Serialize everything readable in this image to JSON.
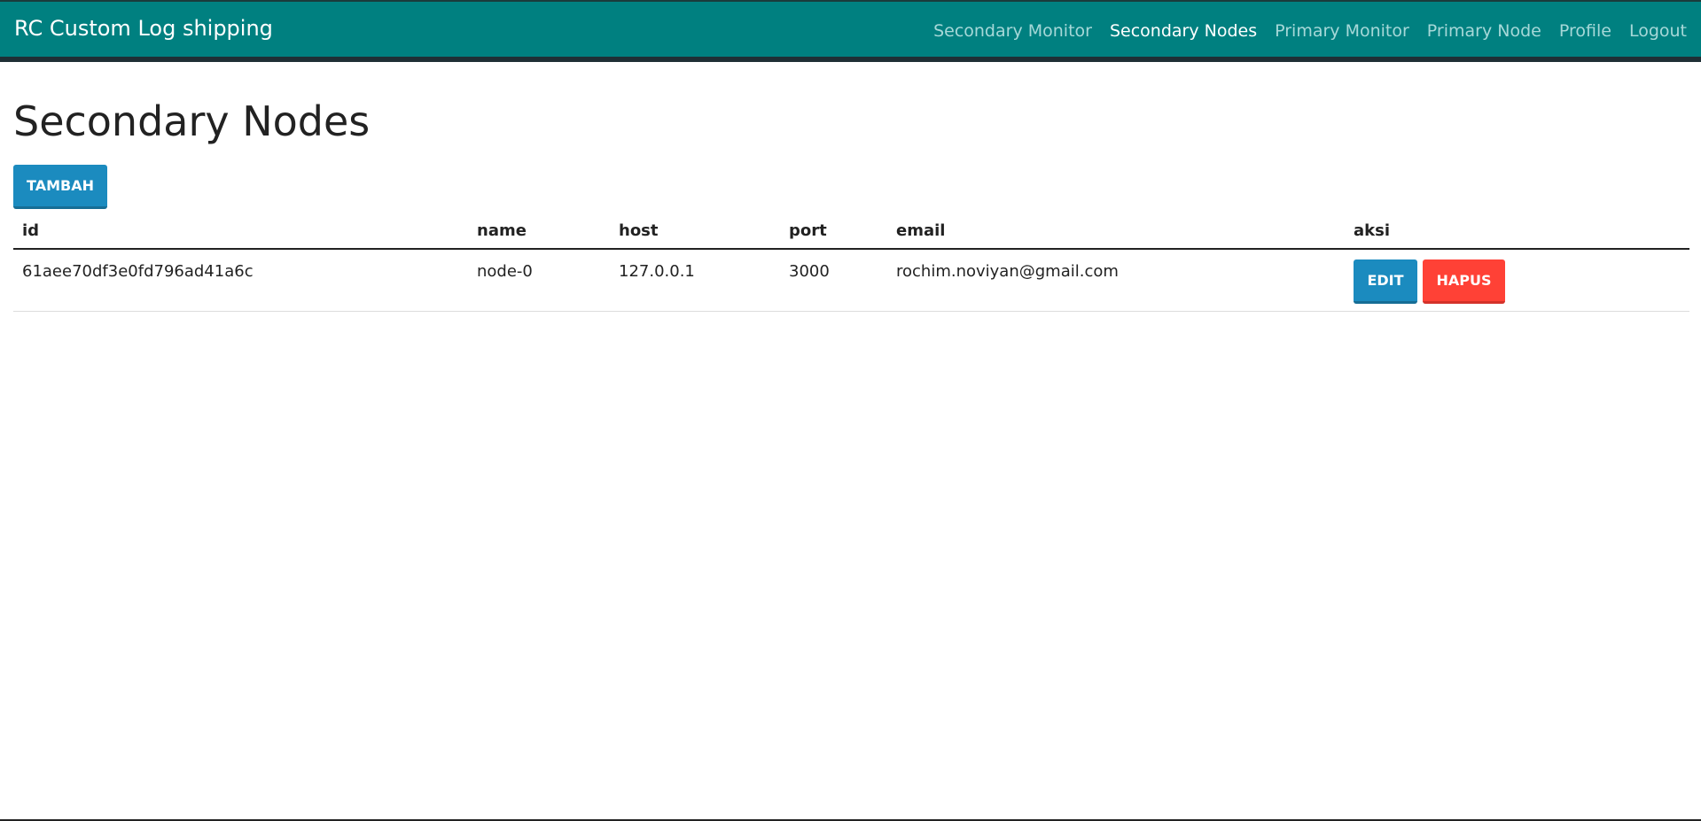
{
  "navbar": {
    "brand": "RC Custom Log shipping",
    "links": [
      {
        "label": "Secondary Monitor",
        "active": false
      },
      {
        "label": "Secondary Nodes",
        "active": true
      },
      {
        "label": "Primary Monitor",
        "active": false
      },
      {
        "label": "Primary Node",
        "active": false
      },
      {
        "label": "Profile",
        "active": false
      },
      {
        "label": "Logout",
        "active": false
      }
    ],
    "bg_color": "#008080"
  },
  "page": {
    "title": "Secondary Nodes",
    "add_button": "TAMBAH"
  },
  "table": {
    "columns": [
      "id",
      "name",
      "host",
      "port",
      "email",
      "aksi"
    ],
    "rows": [
      {
        "id": "61aee70df3e0fd796ad41a6c",
        "name": "node-0",
        "host": "127.0.0.1",
        "port": "3000",
        "email": "rochim.noviyan@gmail.com",
        "edit_label": "EDIT",
        "delete_label": "HAPUS"
      }
    ]
  },
  "colors": {
    "primary_button": "#1b8bbf",
    "danger_button": "#ff4136"
  }
}
